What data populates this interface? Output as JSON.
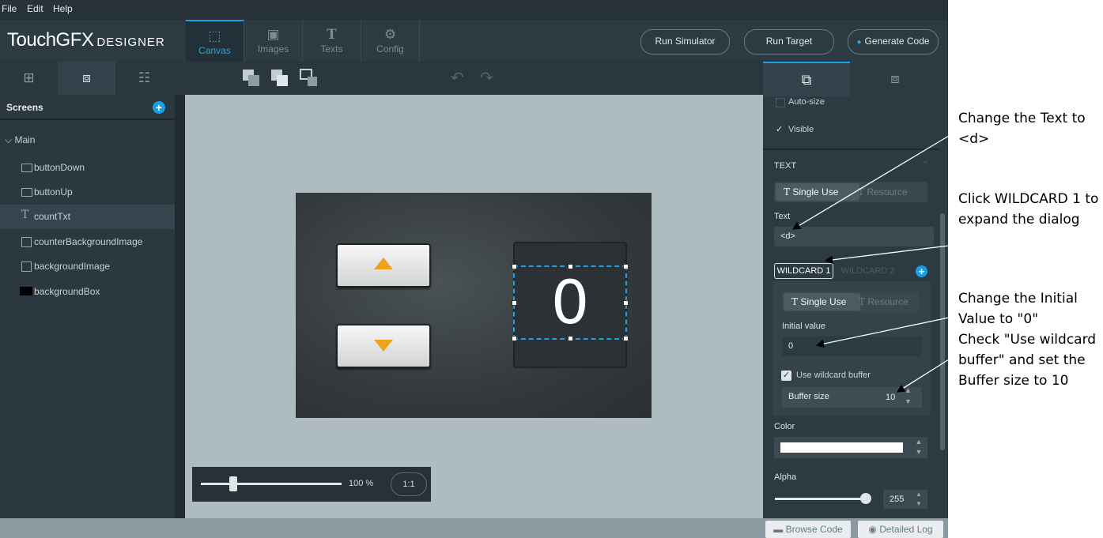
{
  "menu": [
    "File",
    "Edit",
    "Help"
  ],
  "app": {
    "logo_main": "TouchGFX",
    "logo_sub": "DESIGNER"
  },
  "nav_tabs": [
    {
      "label": "Canvas",
      "icon": "canvas-icon"
    },
    {
      "label": "Images",
      "icon": "image-icon"
    },
    {
      "label": "Texts",
      "icon": "text-icon"
    },
    {
      "label": "Config",
      "icon": "gear-icon"
    }
  ],
  "header_buttons": {
    "run_simulator": "Run Simulator",
    "run_target": "Run Target",
    "generate_code": "Generate Code"
  },
  "screens_panel": {
    "title": "Screens",
    "screen_name": "Main",
    "items": [
      {
        "label": "buttonDown",
        "icon": "button-icon"
      },
      {
        "label": "buttonUp",
        "icon": "button-icon"
      },
      {
        "label": "countTxt",
        "icon": "text-icon"
      },
      {
        "label": "counterBackgroundImage",
        "icon": "image-icon"
      },
      {
        "label": "backgroundImage",
        "icon": "image-icon"
      },
      {
        "label": "backgroundBox",
        "icon": "box-icon"
      }
    ]
  },
  "canvas": {
    "count_value": "0",
    "zoom_percent": "100 %",
    "zoom_reset": "1:1",
    "zoom_level": 0.22
  },
  "properties": {
    "auto_size": "Auto-size",
    "visible": "Visible",
    "section_text": "TEXT",
    "single_use": "Single Use",
    "resource": "Resource",
    "text_label": "Text",
    "text_value": "<d>",
    "wildcard1": "WILDCARD 1",
    "wildcard2": "WILDCARD 2",
    "initial_value_label": "Initial value",
    "initial_value": "0",
    "use_wildcard_buffer": "Use wildcard buffer",
    "buffer_size_label": "Buffer size",
    "buffer_size": "10",
    "color_label": "Color",
    "color_value": "#ffffff",
    "alpha_label": "Alpha",
    "alpha_value": "255",
    "alpha_level": 1.0
  },
  "bottom": {
    "browse_code": "Browse Code",
    "detailed_log": "Detailed Log"
  },
  "annotations": {
    "a1": "Change the Text to <d>",
    "a2": "Click WILDCARD 1 to expand the dialog",
    "a3": "Change the Initial Value to \"0\"\nCheck \"Use wildcard buffer\" and set the Buffer size to 10"
  },
  "colors": {
    "accent": "#1aa0e8",
    "arrow_orange": "#f0a31a"
  }
}
